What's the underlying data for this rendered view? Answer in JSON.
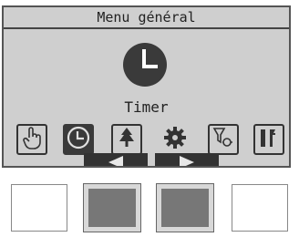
{
  "screen": {
    "title": "Menu général",
    "selected_label": "Timer",
    "menu_items": [
      {
        "name": "operation",
        "icon": "hand-pointer-icon"
      },
      {
        "name": "timer",
        "icon": "clock-icon",
        "selected": true
      },
      {
        "name": "energy-saving",
        "icon": "tree-icon"
      },
      {
        "name": "initial-setting",
        "icon": "gear-icon"
      },
      {
        "name": "service",
        "icon": "filter-settings-icon"
      },
      {
        "name": "maintenance",
        "icon": "tools-icon"
      }
    ],
    "nav": [
      "left-arrow-icon",
      "right-arrow-icon"
    ]
  },
  "hardware_buttons": [
    {
      "name": "f1",
      "style": "light"
    },
    {
      "name": "f2",
      "style": "dark"
    },
    {
      "name": "f3",
      "style": "dark"
    },
    {
      "name": "f4",
      "style": "light"
    }
  ]
}
